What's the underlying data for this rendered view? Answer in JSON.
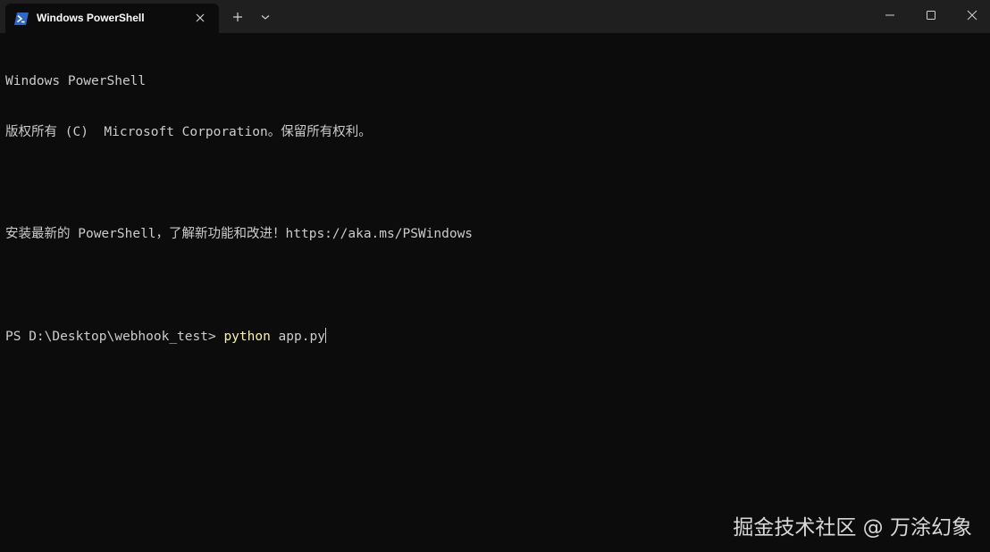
{
  "window": {
    "tab_title": "Windows PowerShell",
    "icons": {
      "tab": "powershell-icon",
      "close_tab": "close-icon",
      "new_tab": "plus-icon",
      "dropdown": "chevron-down-icon",
      "minimize": "minimize-icon",
      "maximize": "maximize-icon",
      "close": "close-icon"
    }
  },
  "terminal": {
    "line1": "Windows PowerShell",
    "line2": "版权所有 (C)  Microsoft Corporation。保留所有权利。",
    "line3": "",
    "line4": "安装最新的 PowerShell，了解新功能和改进！https://aka.ms/PSWindows",
    "line5": "",
    "prompt": "PS D:\\Desktop\\webhook_test> ",
    "command": "python",
    "args": " app.py"
  },
  "watermark": "掘金技术社区 @ 万涂幻象",
  "colors": {
    "background": "#0c0c0c",
    "titlebar": "#1f1f1f",
    "text": "#cccccc",
    "command": "#f9f1a5",
    "tab_icon": "#2f67c7"
  }
}
